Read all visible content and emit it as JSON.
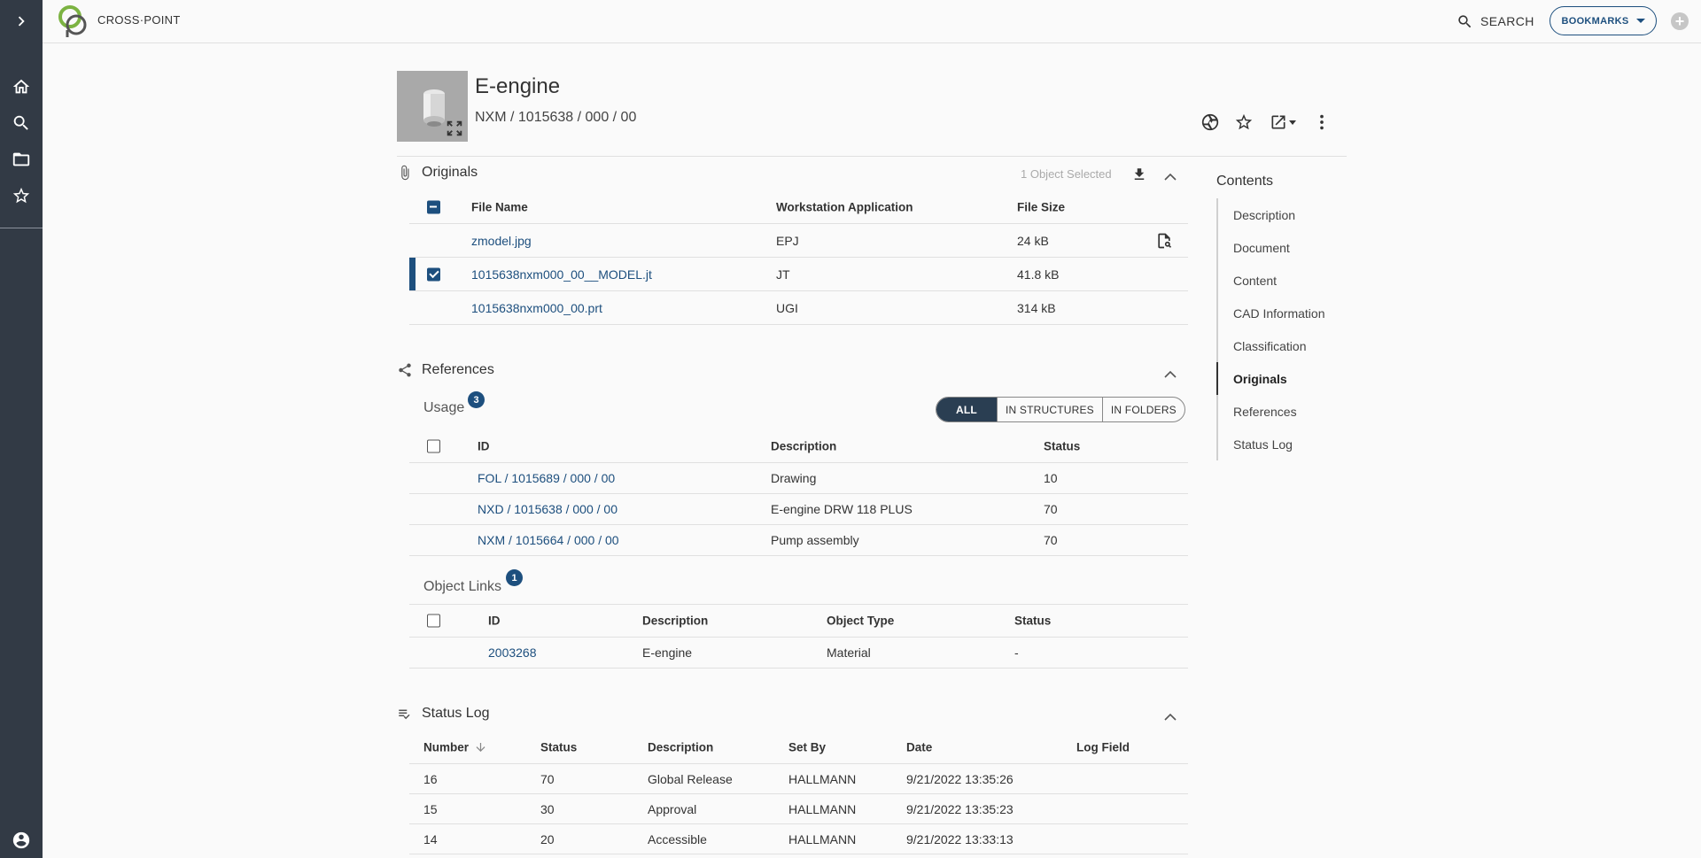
{
  "app": {
    "brand": "CROSS·POINT"
  },
  "topbar": {
    "search_label": "SEARCH",
    "bookmarks_label": "BOOKMARKS",
    "add_label": "+"
  },
  "header": {
    "title": "E-engine",
    "object_id": "NXM / 1015638 / 000 / 00"
  },
  "originals": {
    "title": "Originals",
    "selected_text": "1 Object Selected",
    "columns": [
      "File Name",
      "Workstation Application",
      "File Size"
    ],
    "rows": [
      {
        "file": "zmodel.jpg",
        "app": "EPJ",
        "size": "24 kB"
      },
      {
        "file": "1015638nxm000_00__MODEL.jt",
        "app": "JT",
        "size": "41.8 kB"
      },
      {
        "file": "1015638nxm000_00.prt",
        "app": "UGI",
        "size": "314 kB"
      }
    ]
  },
  "references": {
    "title": "References",
    "usage": {
      "label": "Usage",
      "count": "3",
      "filters": [
        "ALL",
        "IN STRUCTURES",
        "IN FOLDERS"
      ],
      "columns": [
        "ID",
        "Description",
        "Status"
      ],
      "rows": [
        {
          "id": "FOL / 1015689 / 000 / 00",
          "description": "Drawing",
          "status": "10"
        },
        {
          "id": "NXD / 1015638 / 000 / 00",
          "description": "E-engine DRW 118 PLUS",
          "status": "70"
        },
        {
          "id": "NXM / 1015664 / 000 / 00",
          "description": "Pump assembly",
          "status": "70"
        }
      ]
    },
    "object_links": {
      "label": "Object Links",
      "count": "1",
      "columns": [
        "ID",
        "Description",
        "Object Type",
        "Status"
      ],
      "rows": [
        {
          "id": "2003268",
          "description": "E-engine",
          "type": "Material",
          "status": "-"
        }
      ]
    }
  },
  "status_log": {
    "title": "Status Log",
    "columns": [
      "Number",
      "Status",
      "Description",
      "Set By",
      "Date",
      "Log Field"
    ],
    "rows": [
      {
        "number": "16",
        "status": "70",
        "description": "Global Release",
        "set_by": "HALLMANN",
        "date": "9/21/2022 13:35:26"
      },
      {
        "number": "15",
        "status": "30",
        "description": "Approval",
        "set_by": "HALLMANN",
        "date": "9/21/2022 13:35:23"
      },
      {
        "number": "14",
        "status": "20",
        "description": "Accessible",
        "set_by": "HALLMANN",
        "date": "9/21/2022 13:33:13"
      }
    ]
  },
  "contents": {
    "title": "Contents",
    "items": [
      "Description",
      "Document",
      "Content",
      "CAD Information",
      "Classification",
      "Originals",
      "References",
      "Status Log"
    ],
    "active": "Originals"
  },
  "colors": {
    "rail": "#323a45",
    "accent": "#1d4f7e",
    "badge": "#1d4f7e"
  },
  "icons": [
    "chevron-right-icon",
    "home-icon",
    "search-icon",
    "folder-icon",
    "star-icon",
    "account-icon",
    "paperclip-icon",
    "share-icon",
    "status-log-icon",
    "download-icon",
    "file-preview-icon",
    "collapse-icon",
    "expand-icon",
    "3d-viewer-icon",
    "open-external-icon",
    "more-vertical-icon",
    "sort-down-icon"
  ]
}
